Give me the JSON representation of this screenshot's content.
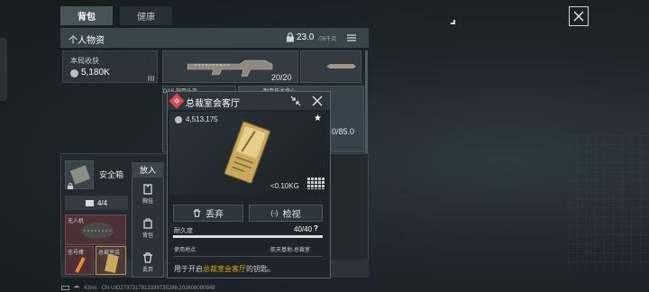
{
  "tabs": [
    "背包",
    "健康"
  ],
  "header": {
    "title": "个人物资",
    "weight_main": "23.0",
    "weight_max": "/76千克"
  },
  "earnings": {
    "label": "本局收获",
    "value": "5,180K"
  },
  "weapon": {
    "ammo": "20/20"
  },
  "stash_weight": "0/85.0",
  "safe_box": {
    "label": "安全箱"
  },
  "place_in": {
    "label": "放入",
    "options": [
      "胸挂",
      "背包",
      "丢弃"
    ]
  },
  "backpack_tab": {
    "count": "4/4"
  },
  "bag_items": [
    {
      "label": "无人机"
    },
    {
      "label": "信号棒"
    },
    {
      "label": "总裁室会"
    }
  ],
  "behind_labels": {
    "ammo": "DAS 穿甲头盔",
    "tech": "耐用技术背心"
  },
  "popup": {
    "title": "总裁室会客厅",
    "price": "4,513,175",
    "weight": "<0.10KG",
    "discard_label": "丢弃",
    "inspect_label": "检视",
    "durability_label": "耐久度",
    "durability_value": "40/40",
    "durability_fraction": 1.0,
    "location_label": "使用地点",
    "location_value": "航天基地-总裁室",
    "desc_prefix": "用于开启",
    "desc_highlight": "总裁室会客厅",
    "desc_suffix": "的钥匙。",
    "accent": "#e0a10b",
    "key_red": "#d94a4a"
  },
  "status": {
    "ping": "43ms",
    "uid": "CN UID2737317813339735286,202608090948"
  }
}
